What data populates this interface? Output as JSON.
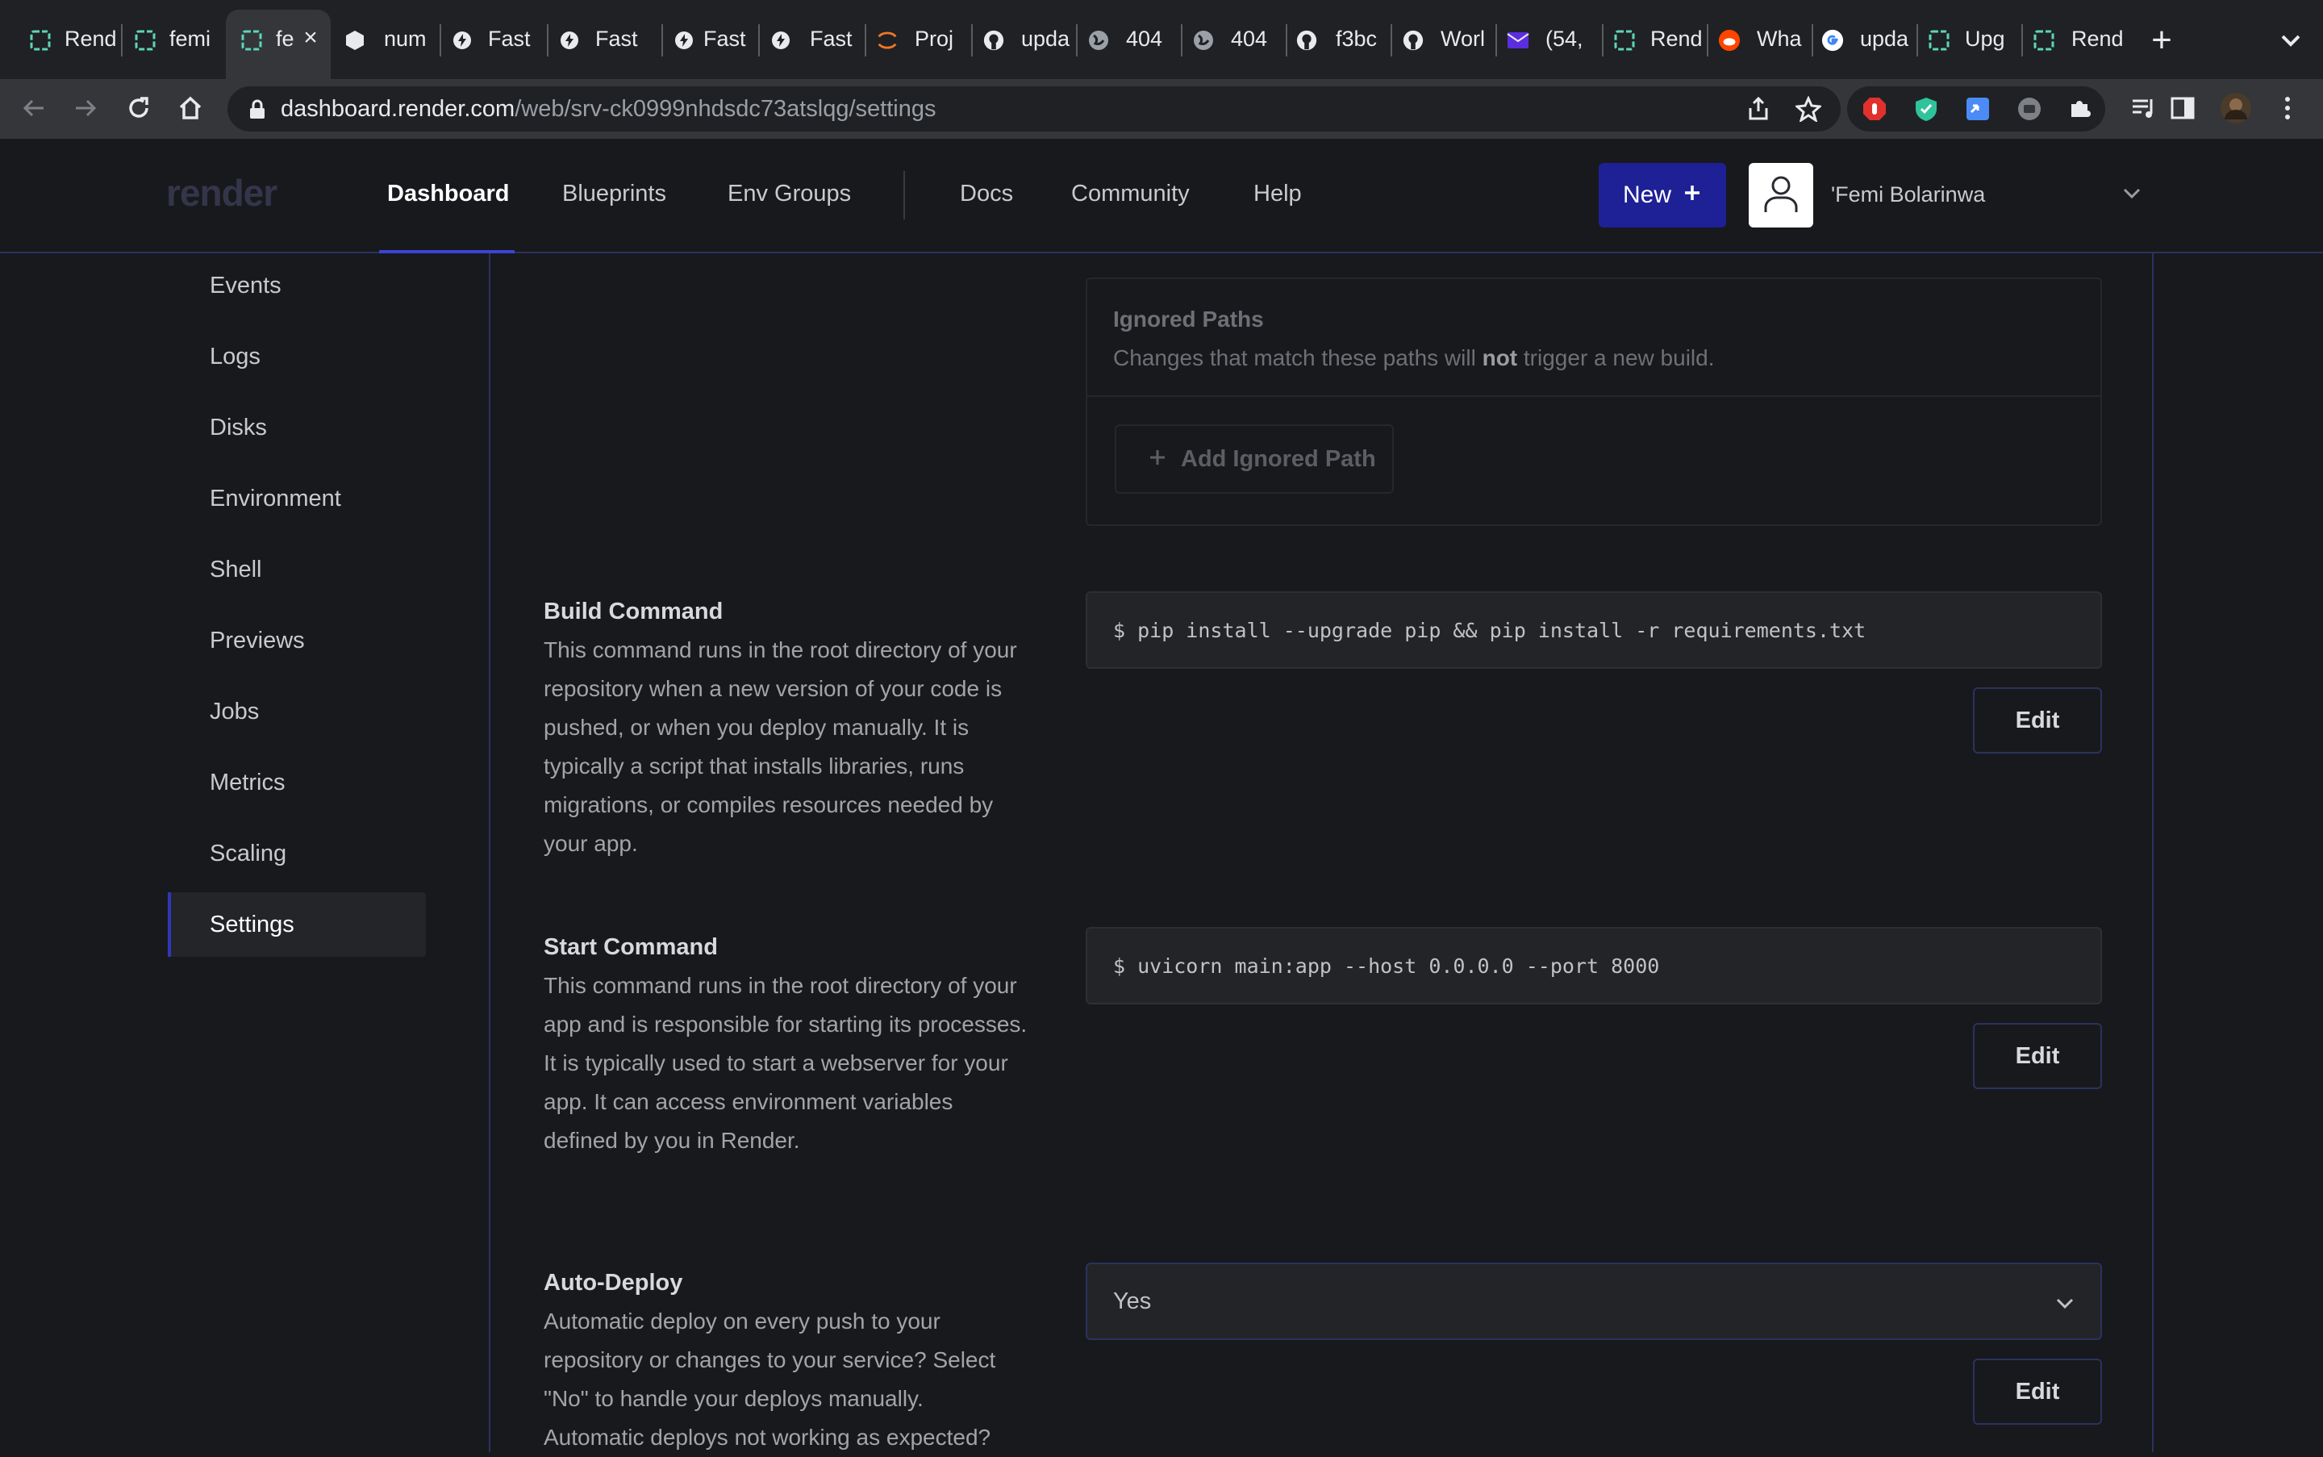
{
  "browser": {
    "tabs": [
      {
        "title": "Rend",
        "icon": "render-icon"
      },
      {
        "title": "femi",
        "icon": "render-icon"
      },
      {
        "title": "fe",
        "icon": "render-icon",
        "active": true
      },
      {
        "title": "num",
        "icon": "cube-icon"
      },
      {
        "title": "Fast",
        "icon": "fastapi-icon"
      },
      {
        "title": "Fast",
        "icon": "fastapi-icon"
      },
      {
        "title": "Fast",
        "icon": "fastapi-icon"
      },
      {
        "title": "Fast",
        "icon": "fastapi-icon"
      },
      {
        "title": "Proj",
        "icon": "jupyter-icon"
      },
      {
        "title": "upda",
        "icon": "github-icon"
      },
      {
        "title": "404",
        "icon": "globe-icon"
      },
      {
        "title": "404",
        "icon": "globe-icon"
      },
      {
        "title": "f3bc",
        "icon": "github-icon"
      },
      {
        "title": "Worl",
        "icon": "github-icon"
      },
      {
        "title": "(54,",
        "icon": "mail-icon"
      },
      {
        "title": "Rend",
        "icon": "render-icon"
      },
      {
        "title": "Wha",
        "icon": "reddit-icon"
      },
      {
        "title": "upda",
        "icon": "google-icon"
      },
      {
        "title": "Upg",
        "icon": "render-icon"
      },
      {
        "title": "Rend",
        "icon": "render-icon"
      }
    ],
    "url_domain": "dashboard.render.com",
    "url_path": "/web/srv-ck0999nhdsdc73atslqg/settings"
  },
  "header": {
    "logo": "render",
    "nav": {
      "dashboard": "Dashboard",
      "blueprints": "Blueprints",
      "env_groups": "Env Groups",
      "docs": "Docs",
      "community": "Community",
      "help": "Help"
    },
    "new_button": "New",
    "user_name": "'Femi Bolarinwa"
  },
  "sidebar": {
    "items": [
      "Events",
      "Logs",
      "Disks",
      "Environment",
      "Shell",
      "Previews",
      "Jobs",
      "Metrics",
      "Scaling",
      "Settings"
    ],
    "active": "Settings"
  },
  "ignored_paths": {
    "title": "Ignored Paths",
    "desc_before": "Changes that match these paths will ",
    "desc_bold": "not",
    "desc_after": " trigger a new build.",
    "add_button": "Add Ignored Path"
  },
  "build_command": {
    "title": "Build Command",
    "description": "This command runs in the root directory of your repository when a new version of your code is pushed, or when you deploy manually. It is typically a script that installs libraries, runs migrations, or compiles resources needed by your app.",
    "value": "$ pip install --upgrade pip && pip install -r requirements.txt",
    "edit_label": "Edit"
  },
  "start_command": {
    "title": "Start Command",
    "description": "This command runs in the root directory of your app and is responsible for starting its processes. It is typically used to start a webserver for your app. It can access environment variables defined by you in Render.",
    "value": "$ uvicorn main:app --host 0.0.0.0 --port 8000",
    "edit_label": "Edit"
  },
  "auto_deploy": {
    "title": "Auto-Deploy",
    "description": "Automatic deploy on every push to your repository or changes to your service? Select \"No\" to handle your deploys manually. Automatic deploys not working as expected?",
    "value": "Yes",
    "edit_label": "Edit"
  }
}
